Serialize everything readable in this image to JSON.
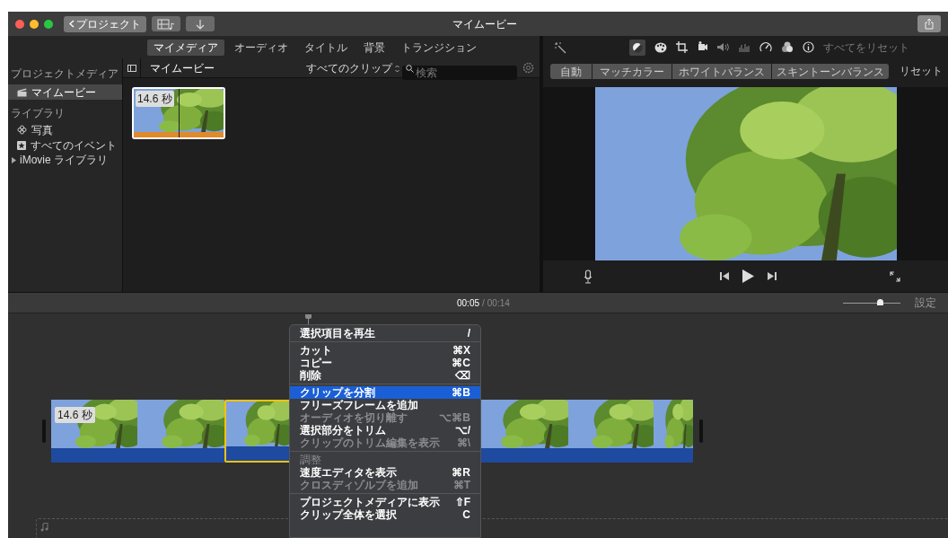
{
  "window": {
    "title": "マイムービー",
    "back_button": "プロジェクト"
  },
  "media_tabs": [
    {
      "label": "マイメディア",
      "selected": true
    },
    {
      "label": "オーディオ",
      "selected": false
    },
    {
      "label": "タイトル",
      "selected": false
    },
    {
      "label": "背景",
      "selected": false
    },
    {
      "label": "トランジション",
      "selected": false
    }
  ],
  "sidebar": {
    "sections": [
      {
        "heading": "プロジェクトメディア",
        "items": [
          {
            "kind": "project",
            "label": "マイムービー",
            "selected": true
          }
        ]
      },
      {
        "heading": "ライブラリ",
        "items": [
          {
            "kind": "photos",
            "label": "写真",
            "selected": false
          },
          {
            "kind": "events",
            "label": "すべてのイベント",
            "selected": false
          }
        ]
      }
    ],
    "library": {
      "label": "iMovie ライブラリ",
      "expanded": false
    }
  },
  "browser": {
    "title": "マイムービー",
    "filter": "すべてのクリップ",
    "search": {
      "placeholder": "検索"
    },
    "clips": [
      {
        "duration": "14.6 秒",
        "selected": true
      }
    ]
  },
  "viewer": {
    "reset_all": {
      "label": "すべてをリセット",
      "disabled": true
    },
    "color_tabs": [
      {
        "label": "自動"
      },
      {
        "label": "マッチカラー"
      },
      {
        "label": "ホワイトバランス"
      },
      {
        "label": "スキントーンバランス"
      }
    ],
    "reset": "リセット"
  },
  "timeline": {
    "timecode": "00:05",
    "separator": "/",
    "duration": "00:14",
    "zoom": {
      "level": 0.65
    },
    "settings": "設定",
    "clip": {
      "duration": "14.6 秒"
    }
  },
  "context_menu": [
    {
      "kind": "item",
      "label": "選択項目を再生",
      "shortcut": "/",
      "disabled": false,
      "selected": false
    },
    {
      "kind": "separator"
    },
    {
      "kind": "item",
      "label": "カット",
      "shortcut": "⌘X",
      "disabled": false,
      "selected": false
    },
    {
      "kind": "item",
      "label": "コピー",
      "shortcut": "⌘C",
      "disabled": false,
      "selected": false
    },
    {
      "kind": "item",
      "label": "削除",
      "shortcut": "⌫",
      "disabled": false,
      "selected": false
    },
    {
      "kind": "separator"
    },
    {
      "kind": "item",
      "label": "クリップを分割",
      "shortcut": "⌘B",
      "disabled": false,
      "selected": true
    },
    {
      "kind": "item",
      "label": "フリーズフレームを追加",
      "disabled": false,
      "selected": false
    },
    {
      "kind": "item",
      "label": "オーディオを切り離す",
      "shortcut": "⌥⌘B",
      "disabled": true,
      "selected": false
    },
    {
      "kind": "item",
      "label": "選択部分をトリム",
      "shortcut": "⌥/",
      "disabled": false,
      "selected": false
    },
    {
      "kind": "item",
      "label": "クリップのトリム編集を表示",
      "shortcut": "⌘\\",
      "disabled": true,
      "selected": false
    },
    {
      "kind": "separator"
    },
    {
      "kind": "header",
      "label": "調整"
    },
    {
      "kind": "item",
      "label": "速度エディタを表示",
      "shortcut": "⌘R",
      "disabled": false,
      "selected": false
    },
    {
      "kind": "item",
      "label": "クロスディゾルブを追加",
      "shortcut": "⌘T",
      "disabled": true,
      "selected": false
    },
    {
      "kind": "separator"
    },
    {
      "kind": "item",
      "label": "プロジェクトメディアに表示",
      "shortcut": "⇧F",
      "disabled": false,
      "selected": false
    },
    {
      "kind": "item",
      "label": "クリップ全体を選択",
      "shortcut": "C",
      "disabled": false,
      "selected": false
    }
  ]
}
